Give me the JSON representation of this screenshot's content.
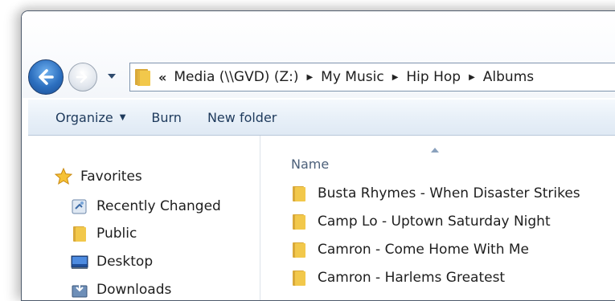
{
  "address_bar": {
    "overflow_glyph": "«",
    "crumbs": [
      "Media (\\\\GVD) (Z:)",
      "My Music",
      "Hip Hop",
      "Albums"
    ]
  },
  "toolbar": {
    "organize_label": "Organize",
    "burn_label": "Burn",
    "new_folder_label": "New folder"
  },
  "nav_pane": {
    "favorites_label": "Favorites",
    "items": [
      {
        "label": "Recently Changed",
        "icon": "recent-places-icon"
      },
      {
        "label": "Public",
        "icon": "folder-icon"
      },
      {
        "label": "Desktop",
        "icon": "desktop-icon"
      },
      {
        "label": "Downloads",
        "icon": "downloads-icon"
      }
    ]
  },
  "file_list": {
    "column_name": "Name",
    "sort_direction": "ascending",
    "items": [
      "Busta Rhymes - When Disaster Strikes",
      "Camp Lo - Uptown Saturday Night",
      "Camron - Come Home With Me",
      "Camron - Harlems Greatest"
    ]
  },
  "colors": {
    "toolbar_text": "#1e3a5c",
    "column_header_text": "#4c607a",
    "folder_yellow": "#f2c84b",
    "back_button_blue": "#2c6fbf"
  }
}
